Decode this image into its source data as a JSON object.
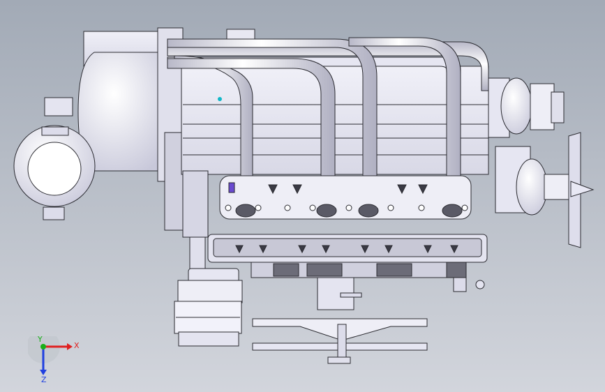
{
  "viewport": {
    "background_top": "#a2aab6",
    "background_bottom": "#d2d5dc"
  },
  "model": {
    "part_fill": "#e8e8f2",
    "part_shade": "#c6c6d4",
    "edge_color": "#2a2a30",
    "dark_panel": "#6c6c78",
    "accent_purple": "#6a4ad0",
    "accent_cyan": "#10b8c8"
  },
  "triad": {
    "x_label": "X",
    "y_label": "Y",
    "z_label": "Z",
    "x_color": "#e02020",
    "y_color": "#18b018",
    "z_color": "#2040e0"
  }
}
